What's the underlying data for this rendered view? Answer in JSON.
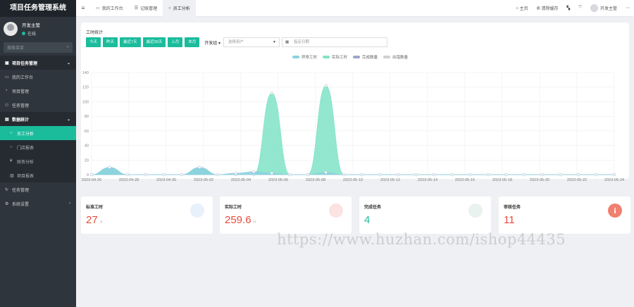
{
  "app": {
    "title": "项目任务管理系统"
  },
  "user": {
    "name": "开发主管",
    "status": "在线"
  },
  "search": {
    "placeholder": "搜索菜单"
  },
  "sidebar": {
    "items": [
      {
        "label": "项目任务管理",
        "icon": "folder-icon",
        "type": "section"
      },
      {
        "label": "我的工作台",
        "icon": "desktop-icon",
        "type": "item"
      },
      {
        "label": "项目管理",
        "icon": "project-icon",
        "type": "item"
      },
      {
        "label": "任务管理",
        "icon": "task-icon",
        "type": "item"
      },
      {
        "label": "数据统计",
        "icon": "chart-icon",
        "type": "section"
      },
      {
        "label": "员工分析",
        "icon": "circle-icon",
        "type": "sub-active"
      },
      {
        "label": "门店报表",
        "icon": "circle-icon",
        "type": "sub"
      },
      {
        "label": "财务分析",
        "icon": "yen-icon",
        "type": "sub"
      },
      {
        "label": "项目报表",
        "icon": "bar-icon",
        "type": "sub"
      },
      {
        "label": "任务管理",
        "icon": "refresh-icon",
        "type": "item"
      },
      {
        "label": "系统设置",
        "icon": "gear-icon",
        "type": "item"
      }
    ]
  },
  "tabs": [
    {
      "label": "我的工作台",
      "icon": "desktop-icon"
    },
    {
      "label": "记账管理",
      "icon": "list-icon"
    },
    {
      "label": "员工分析",
      "icon": "circle-icon"
    }
  ],
  "topbar": {
    "home": "主页",
    "clear_cache": "清除缓存",
    "user": "开发主管"
  },
  "stats": {
    "title": "工时统计",
    "buttons": [
      "今天",
      "昨天",
      "最近7天",
      "最近30天",
      "上月",
      "本月"
    ],
    "dropdown": "开发组",
    "select_placeholder": "选择用户",
    "date_placeholder": "指定日期"
  },
  "chart_data": {
    "type": "area",
    "legend": [
      "异常工时",
      "实际工时",
      "完成数量",
      "出错数量"
    ],
    "x": [
      "2023-04-26",
      "2023-04-28",
      "2023-04-30",
      "2023-05-02",
      "2023-05-04",
      "2023-05-06",
      "2023-05-08",
      "2023-05-10",
      "2023-05-12",
      "2023-05-14",
      "2023-05-16",
      "2023-05-18",
      "2023-05-20",
      "2023-05-22",
      "2023-05-24"
    ],
    "x_labels": [
      "2023-04-26",
      "2023-04-28",
      "2023-04-30",
      "2023-05-02",
      "2023-05-04",
      "2023-05-06",
      "2023-05-08",
      "2023-05-10",
      "2023-05-12",
      "2023-05-14",
      "2023-05-16",
      "2023-05-18",
      "2023-05-20",
      "2023-05-22",
      "2023-05-24"
    ],
    "ylim": [
      0,
      140
    ],
    "yticks": [
      0,
      20,
      40,
      60,
      80,
      100,
      120,
      140
    ],
    "series": [
      {
        "name": "实际工时",
        "color": "#7fe3c6",
        "values": [
          0,
          9,
          0,
          0,
          0,
          0,
          9,
          0,
          0,
          0,
          112,
          0,
          0,
          122,
          0,
          0,
          0,
          0,
          0,
          0,
          0,
          0,
          0,
          0,
          0,
          0,
          0,
          0,
          0,
          0
        ]
      },
      {
        "name": "异常工时",
        "color": "#8bd0e0",
        "values": [
          0,
          10,
          0,
          0,
          0,
          0,
          10,
          0,
          2,
          4,
          2,
          0,
          0,
          3,
          0,
          0,
          0,
          0,
          0,
          0,
          0,
          0,
          0,
          0,
          0,
          0,
          0,
          0,
          0,
          0
        ]
      }
    ]
  },
  "cards": [
    {
      "title": "标准工时",
      "value": "27",
      "unit": "H",
      "color": "#e74c3c",
      "icon": "clock-icon",
      "icon_color": "#e8f0fb"
    },
    {
      "title": "实际工时",
      "value": "259.6",
      "unit": "H",
      "color": "#e74c3c",
      "icon": "calendar-icon",
      "icon_color": "#fbe3e3"
    },
    {
      "title": "完成任务",
      "value": "4",
      "unit": "",
      "color": "#1abc9c",
      "icon": "refresh-icon",
      "icon_color": "#eaf2f0"
    },
    {
      "title": "审核任务",
      "value": "11",
      "unit": "",
      "color": "#e74c3c",
      "icon": "info-icon",
      "icon_color": "#f08070"
    }
  ],
  "watermark": "https://www.huzhan.com/ishop44435"
}
